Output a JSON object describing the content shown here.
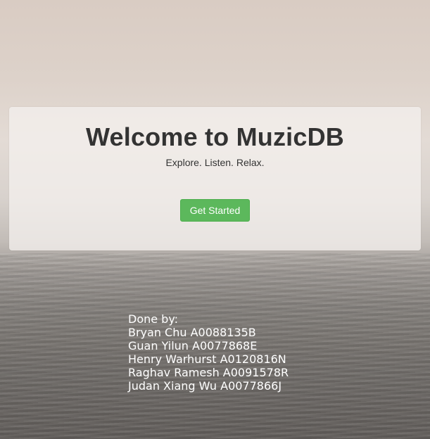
{
  "hero": {
    "title": "Welcome to MuzicDB",
    "tagline": "Explore. Listen. Relax.",
    "cta_label": "Get Started"
  },
  "credits": {
    "heading": "Done by:",
    "members": [
      "Bryan Chu A0088135B",
      "Guan Yilun A0077868E",
      "Henry Warhurst A0120816N",
      "Raghav Ramesh A0091578R",
      "Judan Xiang Wu A0077866J"
    ]
  },
  "colors": {
    "cta_green": "#5cb85c",
    "panel": "#f4f0ed",
    "heading_text": "#333333"
  }
}
